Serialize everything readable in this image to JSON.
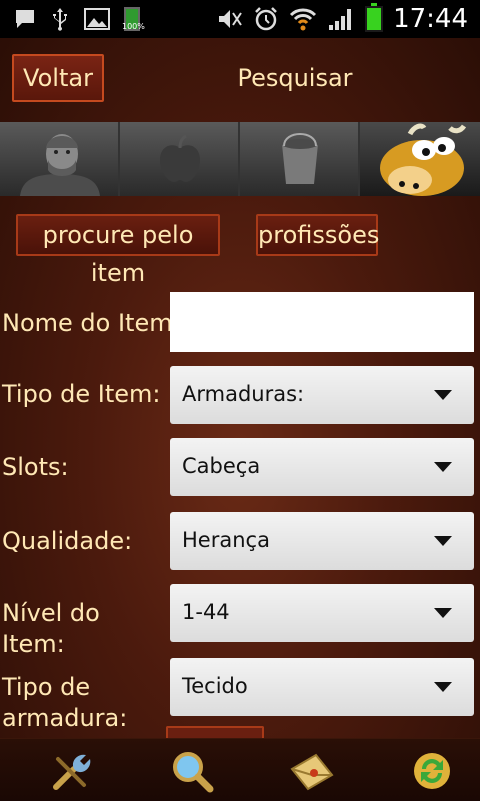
{
  "status_bar": {
    "time": "17:44",
    "battery_small_label": "100%",
    "icons": [
      "chat-icon",
      "usb-icon",
      "image-icon",
      "battery-small-icon",
      "mute-icon",
      "alarm-icon",
      "wifi-icon",
      "signal-icon",
      "battery-icon"
    ]
  },
  "header": {
    "back_label": "Voltar",
    "title": "Pesquisar"
  },
  "tabs": [
    {
      "icon": "character-icon"
    },
    {
      "icon": "apple-icon"
    },
    {
      "icon": "bucket-icon"
    },
    {
      "icon": "cow-icon"
    }
  ],
  "actions": {
    "search_item_label": "procure pelo item",
    "professions_label": "profissões"
  },
  "form": {
    "name_label": "Nome do Item:",
    "name_value": "",
    "type_label": "Tipo de Item:",
    "type_value": "Armaduras:",
    "slots_label": "Slots:",
    "slots_value": "Cabeça",
    "quality_label": "Qualidade:",
    "quality_value": "Herança",
    "level_label": "Nível do Item:",
    "level_value": "1-44",
    "armor_label": "Tipo de armadura:",
    "armor_value": "Tecido"
  },
  "bottom_bar": {
    "icons": [
      "tools-icon",
      "search-icon",
      "mail-icon",
      "refresh-icon"
    ]
  },
  "colors": {
    "text_cream": "#ffe8b5",
    "button_red": "#6a1f10",
    "battery_green": "#38d21f"
  }
}
